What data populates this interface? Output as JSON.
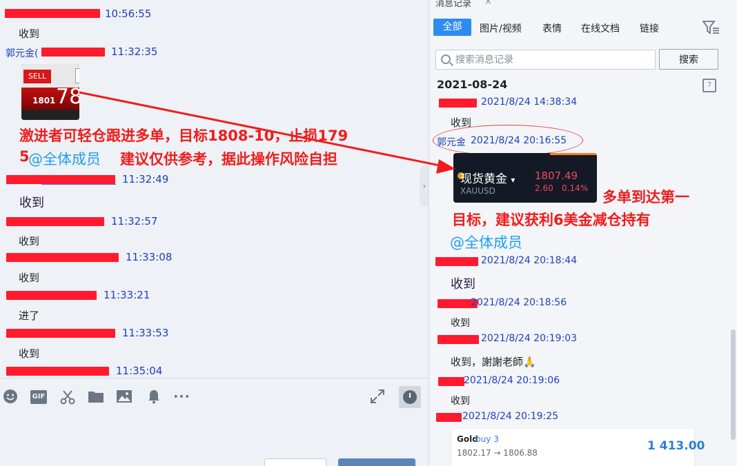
{
  "left_chat": {
    "messages": [
      {
        "sender": "",
        "time": "10:56:55",
        "text": "收到"
      },
      {
        "sender": "郭元金(",
        "time": "11:32:35",
        "text": ""
      },
      {
        "sender": "",
        "time": "11:32:49",
        "text": "收到"
      },
      {
        "sender": "",
        "time": "11:32:57",
        "text": "收到"
      },
      {
        "sender": "",
        "time": "11:33:08",
        "text": "收到"
      },
      {
        "sender": "",
        "time": "11:33:21",
        "text": "进了"
      },
      {
        "sender": "",
        "time": "11:33:53",
        "text": "收到"
      },
      {
        "sender": "",
        "time": "11:35:04",
        "text": ""
      }
    ],
    "sell_widget": {
      "sell_label": "SELL",
      "num_small": "1801",
      "num_big": "78"
    },
    "annotation": {
      "line1": "激进者可轻仓跟进多单，目标1808-10，止损179",
      "line2_prefix": "5",
      "line2_at": "@全体成员",
      "line2_rest": "建议仅供参考，据此操作风险自担"
    }
  },
  "toolbar": {
    "icons": [
      "emoji-icon",
      "gif-icon",
      "scissors-icon",
      "folder-icon",
      "image-icon",
      "bell-icon",
      "more-icon",
      "expand-icon",
      "clock-icon"
    ],
    "gif_label": "GIF",
    "more_label": "•••"
  },
  "history": {
    "panel_title": "消息记录",
    "close_label": "×",
    "tabs": [
      "全部",
      "图片/视频",
      "表情",
      "在线文档",
      "链接"
    ],
    "search_placeholder": "搜索消息记录",
    "search_button": "搜索",
    "date_header": "2021-08-24",
    "calendar_day": "7",
    "collapse_arrow": "›",
    "entries": [
      {
        "sender": "",
        "time": "2021/8/24 14:38:34",
        "text": "收到"
      },
      {
        "sender": "郭元金",
        "time": "2021/8/24 20:16:55",
        "text": ""
      },
      {
        "sender": "",
        "time": "2021/8/24 20:18:44",
        "text": "收到"
      },
      {
        "sender": "",
        "time": "2021/8/24 20:18:56",
        "text": "收到"
      },
      {
        "sender": "",
        "time": "2021/8/24 20:19:03",
        "text": "收到，謝謝老師🙏"
      },
      {
        "sender": "",
        "time": "2021/8/24 20:19:06",
        "text": "收到"
      },
      {
        "sender": "",
        "time": "2021/8/24 20:19:25",
        "text": ""
      }
    ],
    "gold_quote": {
      "name": "现货黄金",
      "dropdown": "▾",
      "symbol": "XAUUSD",
      "price": "1807.49",
      "change": "2.60",
      "percent": "0.14%"
    },
    "annotation": {
      "line1": "多单到达第一",
      "line2": "目标，建议获利6美金减仓持有",
      "at": "@全体成员"
    },
    "trade_card": {
      "instrument": "Gold",
      "side": "buy 3",
      "range": "1802.17 → 1806.88",
      "profit": "1 413.00"
    }
  },
  "colors": {
    "accent": "#2d8cf0",
    "link_blue": "#1f3fbf",
    "annotation_red": "#f01c1c",
    "mention_blue": "#1ea0ee",
    "redaction": "#ff1a2e"
  }
}
